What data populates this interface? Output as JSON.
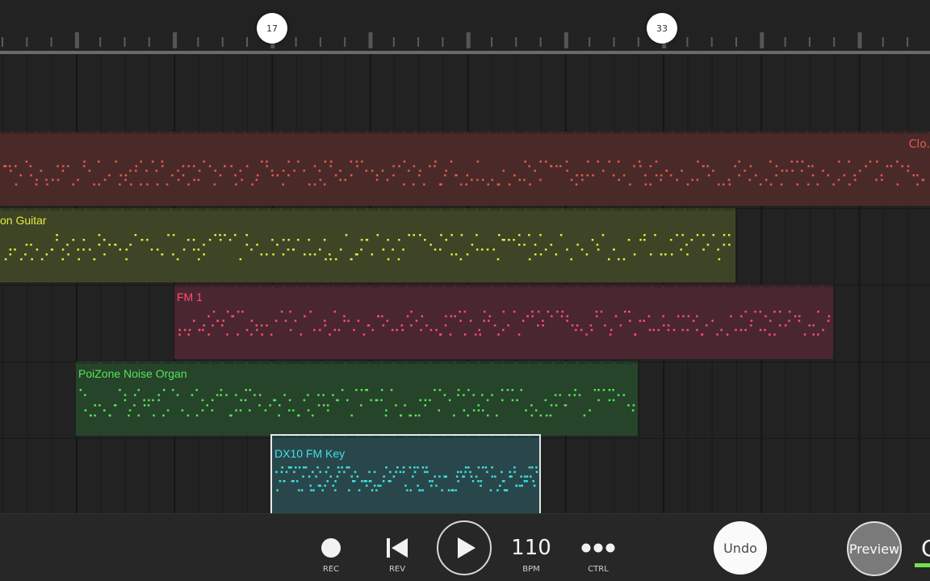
{
  "timeline": {
    "markers": [
      "17",
      "33"
    ]
  },
  "tracks": [
    {
      "name": "Clo.",
      "color": "#e35a4f",
      "bg": "#4a2a28"
    },
    {
      "name": "on Guitar",
      "color": "#e6ea3c",
      "bg": "#3e4426"
    },
    {
      "name": "FM 1",
      "color": "#ff4f6b",
      "bg": "#4a2630"
    },
    {
      "name": "PoiZone Noise Organ",
      "color": "#58e35a",
      "bg": "#26442a"
    },
    {
      "name": "DX10 FM Key",
      "color": "#3fe0e6",
      "bg": "#29474a"
    }
  ],
  "transport": {
    "rec_label": "REC",
    "rev_label": "REV",
    "bpm_value": "110",
    "bpm_label": "BPM",
    "ctrl_label": "CTRL",
    "undo_label": "Undo",
    "preview_label": "Preview",
    "cut_label": "C"
  },
  "icons": [
    "record-icon",
    "skip-back-icon",
    "play-icon",
    "more-dots-icon"
  ]
}
